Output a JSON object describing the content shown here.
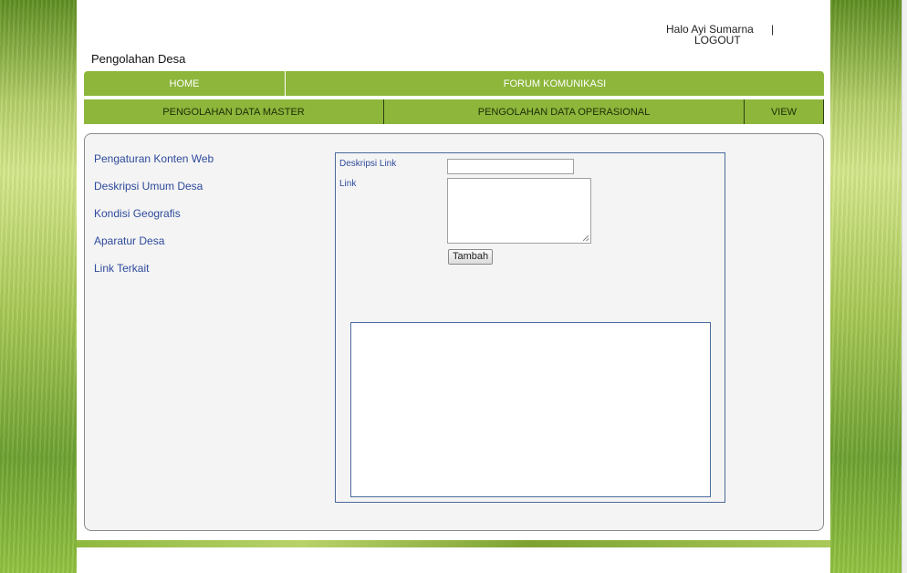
{
  "header": {
    "greeting": "Halo Ayi Sumarna",
    "separator": "|",
    "logout": "LOGOUT",
    "site_title": "Pengolahan Desa"
  },
  "nav_primary": {
    "home": "HOME",
    "forum": "FORUM KOMUNIKASI"
  },
  "nav_secondary": {
    "master": "PENGOLAHAN DATA MASTER",
    "operasional": "PENGOLAHAN DATA OPERASIONAL",
    "view": "VIEW"
  },
  "sidebar": {
    "items": [
      {
        "label": "Pengaturan Konten Web"
      },
      {
        "label": "Deskripsi Umum Desa"
      },
      {
        "label": "Kondisi Geografis"
      },
      {
        "label": "Aparatur Desa"
      },
      {
        "label": "Link Terkait"
      }
    ]
  },
  "form": {
    "desc_label": "Deskripsi Link",
    "desc_value": "",
    "link_label": "Link",
    "link_value": "",
    "submit_label": "Tambah"
  },
  "colors": {
    "nav_green": "#8db63b",
    "link_blue": "#2e4a9c"
  }
}
